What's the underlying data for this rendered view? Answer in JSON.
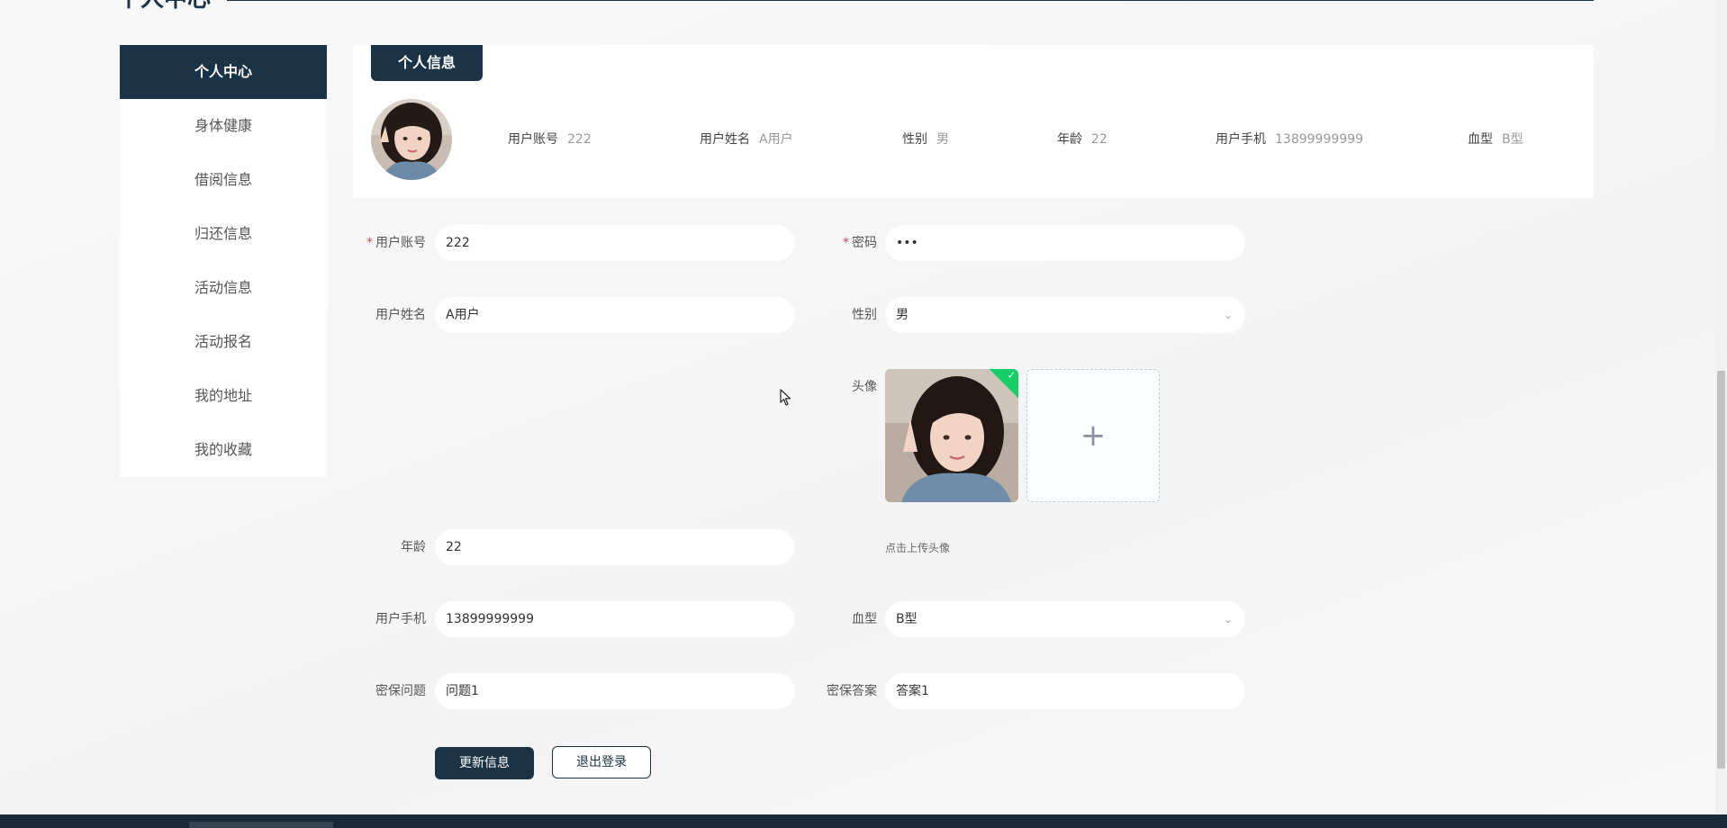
{
  "page": {
    "title": "个人中心"
  },
  "sidebar": {
    "items": [
      {
        "label": "个人中心"
      },
      {
        "label": "身体健康"
      },
      {
        "label": "借阅信息"
      },
      {
        "label": "归还信息"
      },
      {
        "label": "活动信息"
      },
      {
        "label": "活动报名"
      },
      {
        "label": "我的地址"
      },
      {
        "label": "我的收藏"
      }
    ]
  },
  "info_card": {
    "tab_label": "个人信息",
    "fields": [
      {
        "label": "用户账号",
        "value": "222"
      },
      {
        "label": "用户姓名",
        "value": "A用户"
      },
      {
        "label": "性别",
        "value": "男"
      },
      {
        "label": "年龄",
        "value": "22"
      },
      {
        "label": "用户手机",
        "value": "13899999999"
      },
      {
        "label": "血型",
        "value": "B型"
      }
    ]
  },
  "form": {
    "account": {
      "label": "用户账号",
      "value": "222"
    },
    "password": {
      "label": "密码",
      "value": "•••"
    },
    "name": {
      "label": "用户姓名",
      "value": "A用户"
    },
    "gender": {
      "label": "性别",
      "value": "男"
    },
    "avatar": {
      "label": "头像",
      "tip": "点击上传头像"
    },
    "age": {
      "label": "年龄",
      "value": "22"
    },
    "phone": {
      "label": "用户手机",
      "value": "13899999999"
    },
    "blood_type": {
      "label": "血型",
      "value": "B型"
    },
    "question": {
      "label": "密保问题",
      "value": "问题1"
    },
    "answer": {
      "label": "密保答案",
      "value": "答案1"
    },
    "required_mark": "*"
  },
  "actions": {
    "update_label": "更新信息",
    "logout_label": "退出登录"
  },
  "icons": {
    "upload_success": "check-icon",
    "upload_add": "plus-icon",
    "select_arrow": "chevron-down-icon"
  },
  "colors": {
    "primary": "#1b3347",
    "success": "#13ce66",
    "required": "#e0464f"
  }
}
